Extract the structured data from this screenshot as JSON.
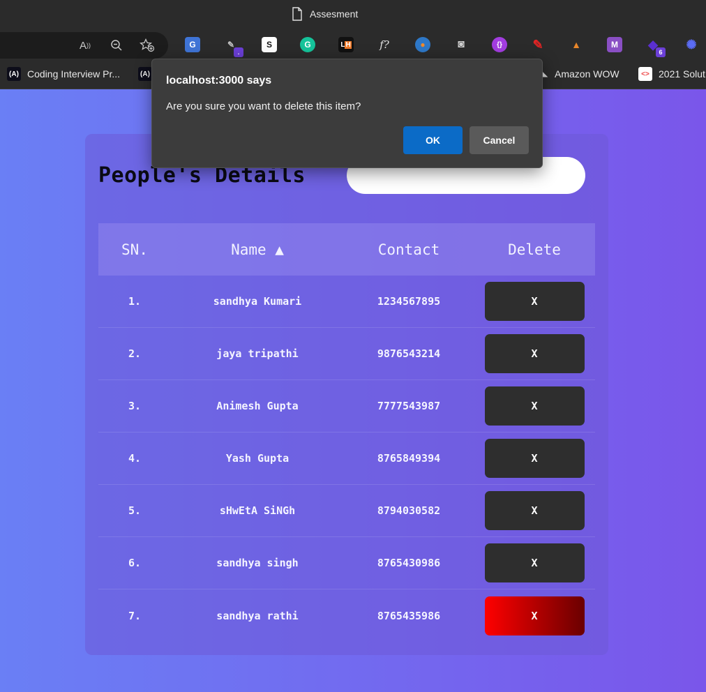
{
  "window": {
    "title": "Assesment"
  },
  "toolbar": {
    "address_icons": [
      "read-aloud-icon",
      "zoom-out-icon",
      "add-favorite-icon"
    ],
    "extensions": [
      {
        "name": "google-translate-icon",
        "glyph": "G",
        "bg": "#3f74d6"
      },
      {
        "name": "pen-extension-icon",
        "glyph": "✎",
        "bg": "transparent",
        "badge": "."
      },
      {
        "name": "s-extension-icon",
        "glyph": "S",
        "bg": "#ffffff"
      },
      {
        "name": "grammarly-icon",
        "glyph": "G",
        "bg": "#15c39a"
      },
      {
        "name": "lh-extension-icon",
        "glyph": "LH",
        "bg": "#111111"
      },
      {
        "name": "function-extension-icon",
        "glyph": "f?",
        "bg": "transparent"
      },
      {
        "name": "bird-extension-icon",
        "glyph": "◉",
        "bg": "transparent"
      },
      {
        "name": "camera-icon",
        "glyph": "◙",
        "bg": "transparent"
      },
      {
        "name": "code-extension-icon",
        "glyph": "{}",
        "bg": "#a33de0"
      },
      {
        "name": "marker-icon",
        "glyph": "✎",
        "bg": "transparent"
      },
      {
        "name": "hat-extension-icon",
        "glyph": "▲",
        "bg": "transparent"
      },
      {
        "name": "m-extension-icon",
        "glyph": "M",
        "bg": "#8a4fc4"
      },
      {
        "name": "stack-extension-icon",
        "glyph": "◆",
        "bg": "transparent",
        "badge": "6"
      },
      {
        "name": "gear-burst-icon",
        "glyph": "✺",
        "bg": "transparent"
      }
    ]
  },
  "bookmarks": {
    "items": [
      {
        "label": "Coding Interview Pr..."
      },
      {
        "label": ""
      },
      {
        "label": "Amazon WOW"
      },
      {
        "label": "2021 Solut"
      }
    ]
  },
  "page": {
    "heading": "People's Details",
    "search": {
      "value": "",
      "placeholder": ""
    },
    "table": {
      "headers": {
        "sn": "SN.",
        "name": "Name ▲",
        "contact": "Contact",
        "delete": "Delete"
      },
      "rows": [
        {
          "sn": "1.",
          "name": "sandhya Kumari",
          "contact": "1234567895",
          "delete": "X"
        },
        {
          "sn": "2.",
          "name": "jaya tripathi",
          "contact": "9876543214",
          "delete": "X"
        },
        {
          "sn": "3.",
          "name": "Animesh Gupta",
          "contact": "7777543987",
          "delete": "X"
        },
        {
          "sn": "4.",
          "name": "Yash Gupta",
          "contact": "8765849394",
          "delete": "X"
        },
        {
          "sn": "5.",
          "name": "sHwEtA SiNGh",
          "contact": "8794030582",
          "delete": "X"
        },
        {
          "sn": "6.",
          "name": "sandhya singh",
          "contact": "8765430986",
          "delete": "X"
        },
        {
          "sn": "7.",
          "name": "sandhya rathi",
          "contact": "8765435986",
          "delete": "X"
        }
      ],
      "hovered_row": 6
    }
  },
  "dialog": {
    "title": "localhost:3000 says",
    "message": "Are you sure you want to delete this item?",
    "ok_label": "OK",
    "cancel_label": "Cancel"
  },
  "colors": {
    "gradient_start": "#6a7ff5",
    "gradient_end": "#7a56ea",
    "ok_button": "#0b6bc7",
    "delete_hover_start": "#ff0000",
    "delete_hover_end": "#6a0000"
  }
}
